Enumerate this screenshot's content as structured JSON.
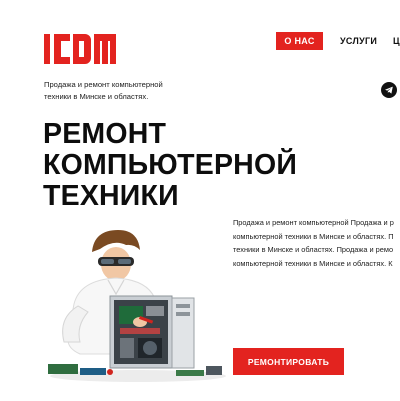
{
  "brand": {
    "logo_text": "ICDM",
    "accent_color": "#e3231f"
  },
  "nav": {
    "items": [
      {
        "label": "О НАС",
        "active": true
      },
      {
        "label": "УСЛУГИ",
        "active": false
      }
    ]
  },
  "header": {
    "tagline_lines": [
      "Продажа и ремонт компьютерной",
      "техники в Минске и областях."
    ],
    "social_icon": "telegram-icon"
  },
  "hero": {
    "title_lines": [
      "РЕМОНТ",
      "КОМПЬЮТЕРНОЙ",
      "ТЕХНИКИ"
    ],
    "description_lines": [
      "Продажа и ремонт компьютерной Продажа и р",
      "компьютерной техники в Минске и областях. П",
      "техники в Минске и областях. Продажа и ремо",
      "компьютерной техники в Минске и областях. К"
    ],
    "cta_label": "РЕМОНТИРОВАТЬ"
  }
}
